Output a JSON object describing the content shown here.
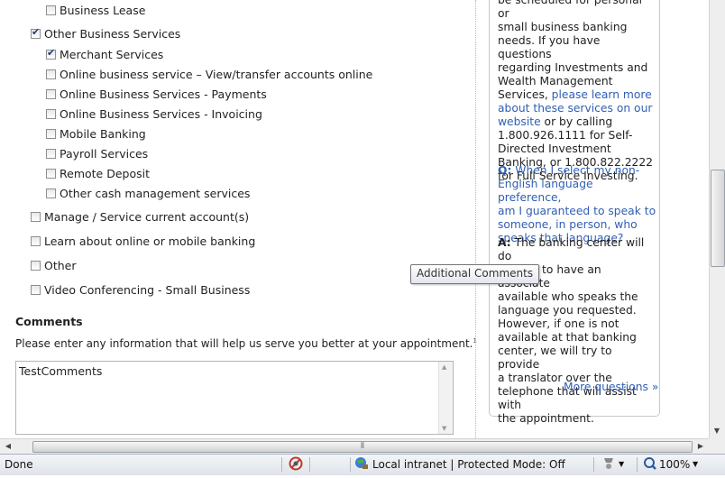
{
  "services": {
    "business_lease": {
      "label": "Business Lease",
      "checked": false
    },
    "other_business_services": {
      "label": "Other Business Services",
      "checked": true,
      "children": [
        {
          "label": "Merchant Services",
          "checked": true
        },
        {
          "label": "Online business service – View/transfer accounts online",
          "checked": false
        },
        {
          "label": "Online Business Services - Payments",
          "checked": false
        },
        {
          "label": "Online Business Services - Invoicing",
          "checked": false
        },
        {
          "label": "Mobile Banking",
          "checked": false
        },
        {
          "label": "Payroll Services",
          "checked": false
        },
        {
          "label": "Remote Deposit",
          "checked": false
        },
        {
          "label": "Other cash management services",
          "checked": false
        }
      ]
    },
    "top_level": [
      {
        "label": "Manage / Service current account(s)",
        "checked": false
      },
      {
        "label": "Learn about online or mobile banking",
        "checked": false
      },
      {
        "label": "Other",
        "checked": false
      },
      {
        "label": "Video Conferencing - Small Business",
        "checked": false
      }
    ]
  },
  "comments": {
    "title": "Comments",
    "hint": "Please enter any information that will help us serve you better at your appointment.",
    "hint_marker": "1",
    "value": "TestComments"
  },
  "tooltip": "Additional Comments",
  "faq": {
    "lines_top": [
      "be scheduled for personal or",
      "small business banking",
      "needs. If you have questions",
      "regarding Investments and",
      "Wealth Management"
    ],
    "services_prefix": "Services, ",
    "learn_more_link_l1": "please learn more",
    "learn_more_link_l2": "about these services on our",
    "learn_more_link_l3": "website",
    "after_link": " or by calling",
    "lines_mid": [
      "1.800.926.1111 for Self-",
      "Directed Investment",
      "Banking, or 1.800.822.2222",
      "for Full Service Investing."
    ],
    "question_prefix": "Q:",
    "question_lines": [
      " When I select my non-",
      "English language preference,",
      "am I guaranteed to speak to",
      "someone, in person, who",
      "speaks that language?"
    ],
    "answer_prefix": "A:",
    "answer_lines": [
      " The banking center will do",
      "its best to have an associate",
      "available who speaks the",
      "language you requested.",
      "However, if one is not",
      "available at that banking",
      "center, we will try to provide",
      "a translator over the",
      "telephone that will assist with",
      "the appointment."
    ],
    "more_link": "More questions »"
  },
  "statusbar": {
    "status": "Done",
    "zone": "Local intranet | Protected Mode: Off",
    "zoom": "100%"
  },
  "icons": {
    "check": "checkmark",
    "privacy": "privacy-icon",
    "globe": "local-intranet-icon",
    "zoom": "zoom-icon"
  }
}
